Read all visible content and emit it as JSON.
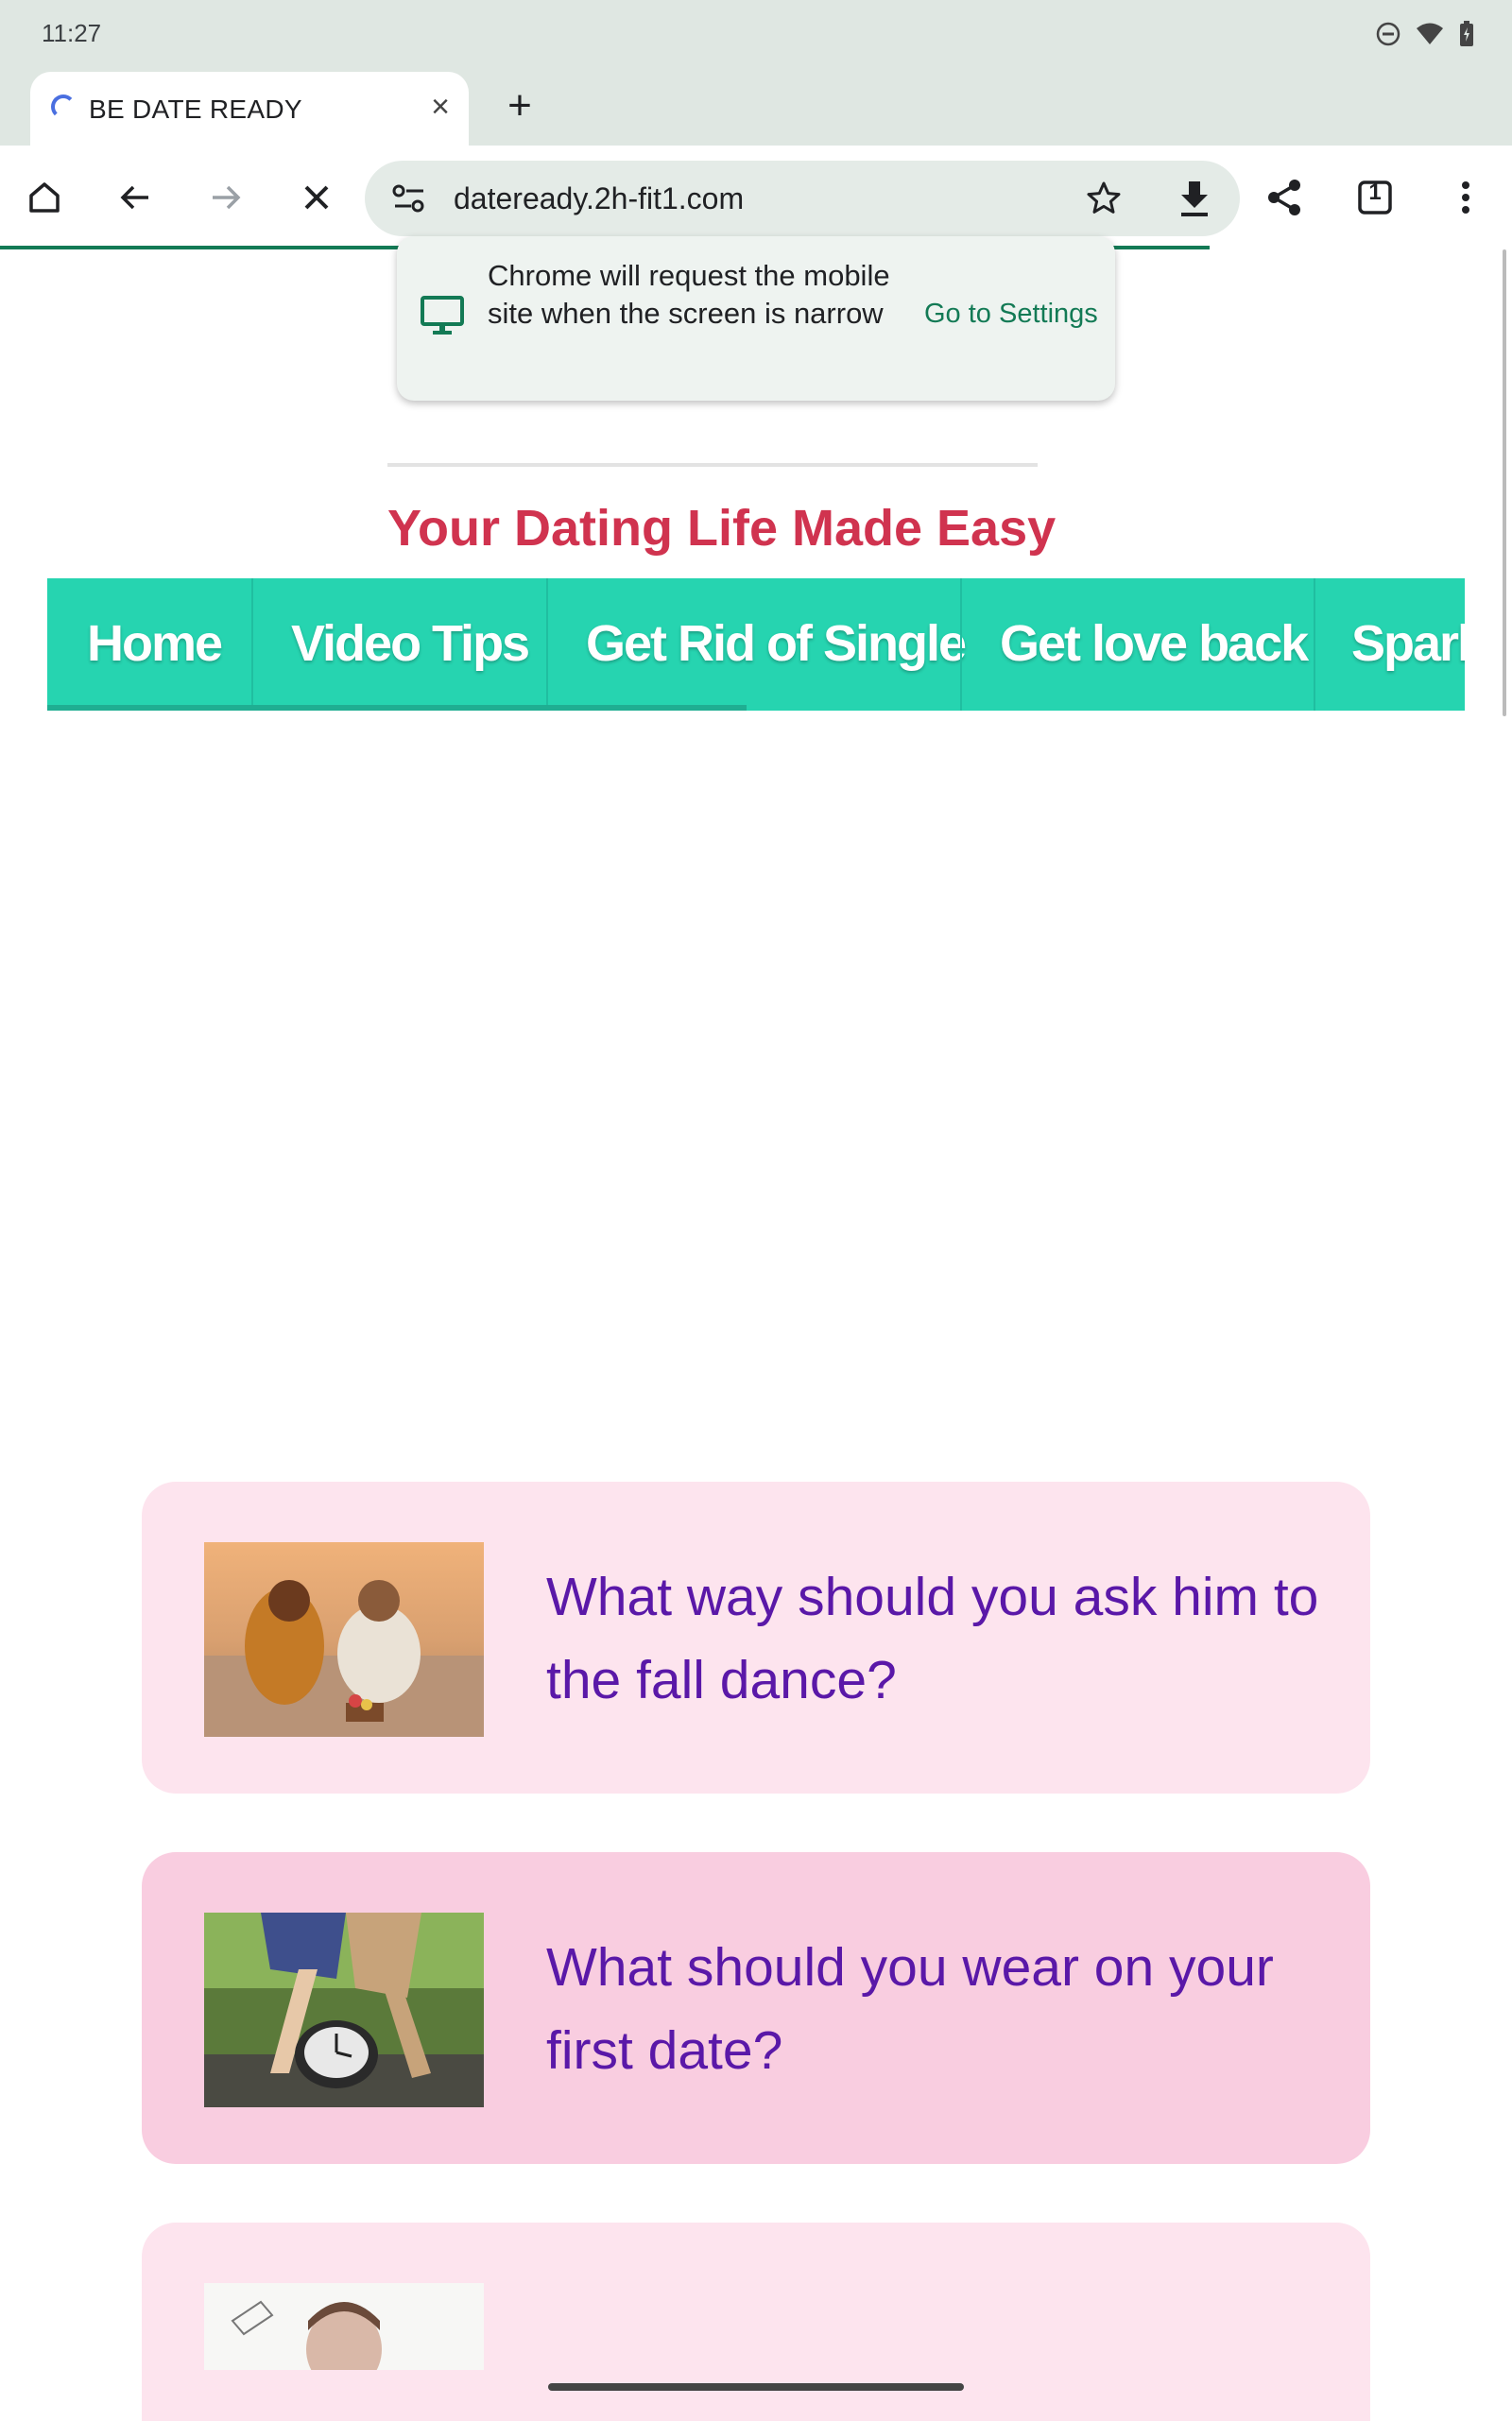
{
  "status": {
    "time": "11:27"
  },
  "tab": {
    "title": "BE DATE READY",
    "close": "×",
    "new_tab": "+",
    "tab_count": "1"
  },
  "omnibox": {
    "url": "dateready.2h-fit1.com"
  },
  "popup": {
    "message": "Chrome will request the mobile site when the screen is narrow",
    "action": "Go to Settings"
  },
  "site": {
    "tagline": "Your Dating Life Made Easy",
    "nav": [
      "Home",
      "Video Tips",
      "Get Rid of Single",
      "Get love back",
      "Spark"
    ]
  },
  "cards": [
    {
      "title": "What way should you ask him to the fall dance?"
    },
    {
      "title": "What should you wear on your first date?"
    }
  ],
  "colors": {
    "accent_green": "#137a55",
    "nav_teal": "#26d4b0",
    "tagline_red": "#d0334f",
    "card_title_purple": "#5a18a8"
  }
}
